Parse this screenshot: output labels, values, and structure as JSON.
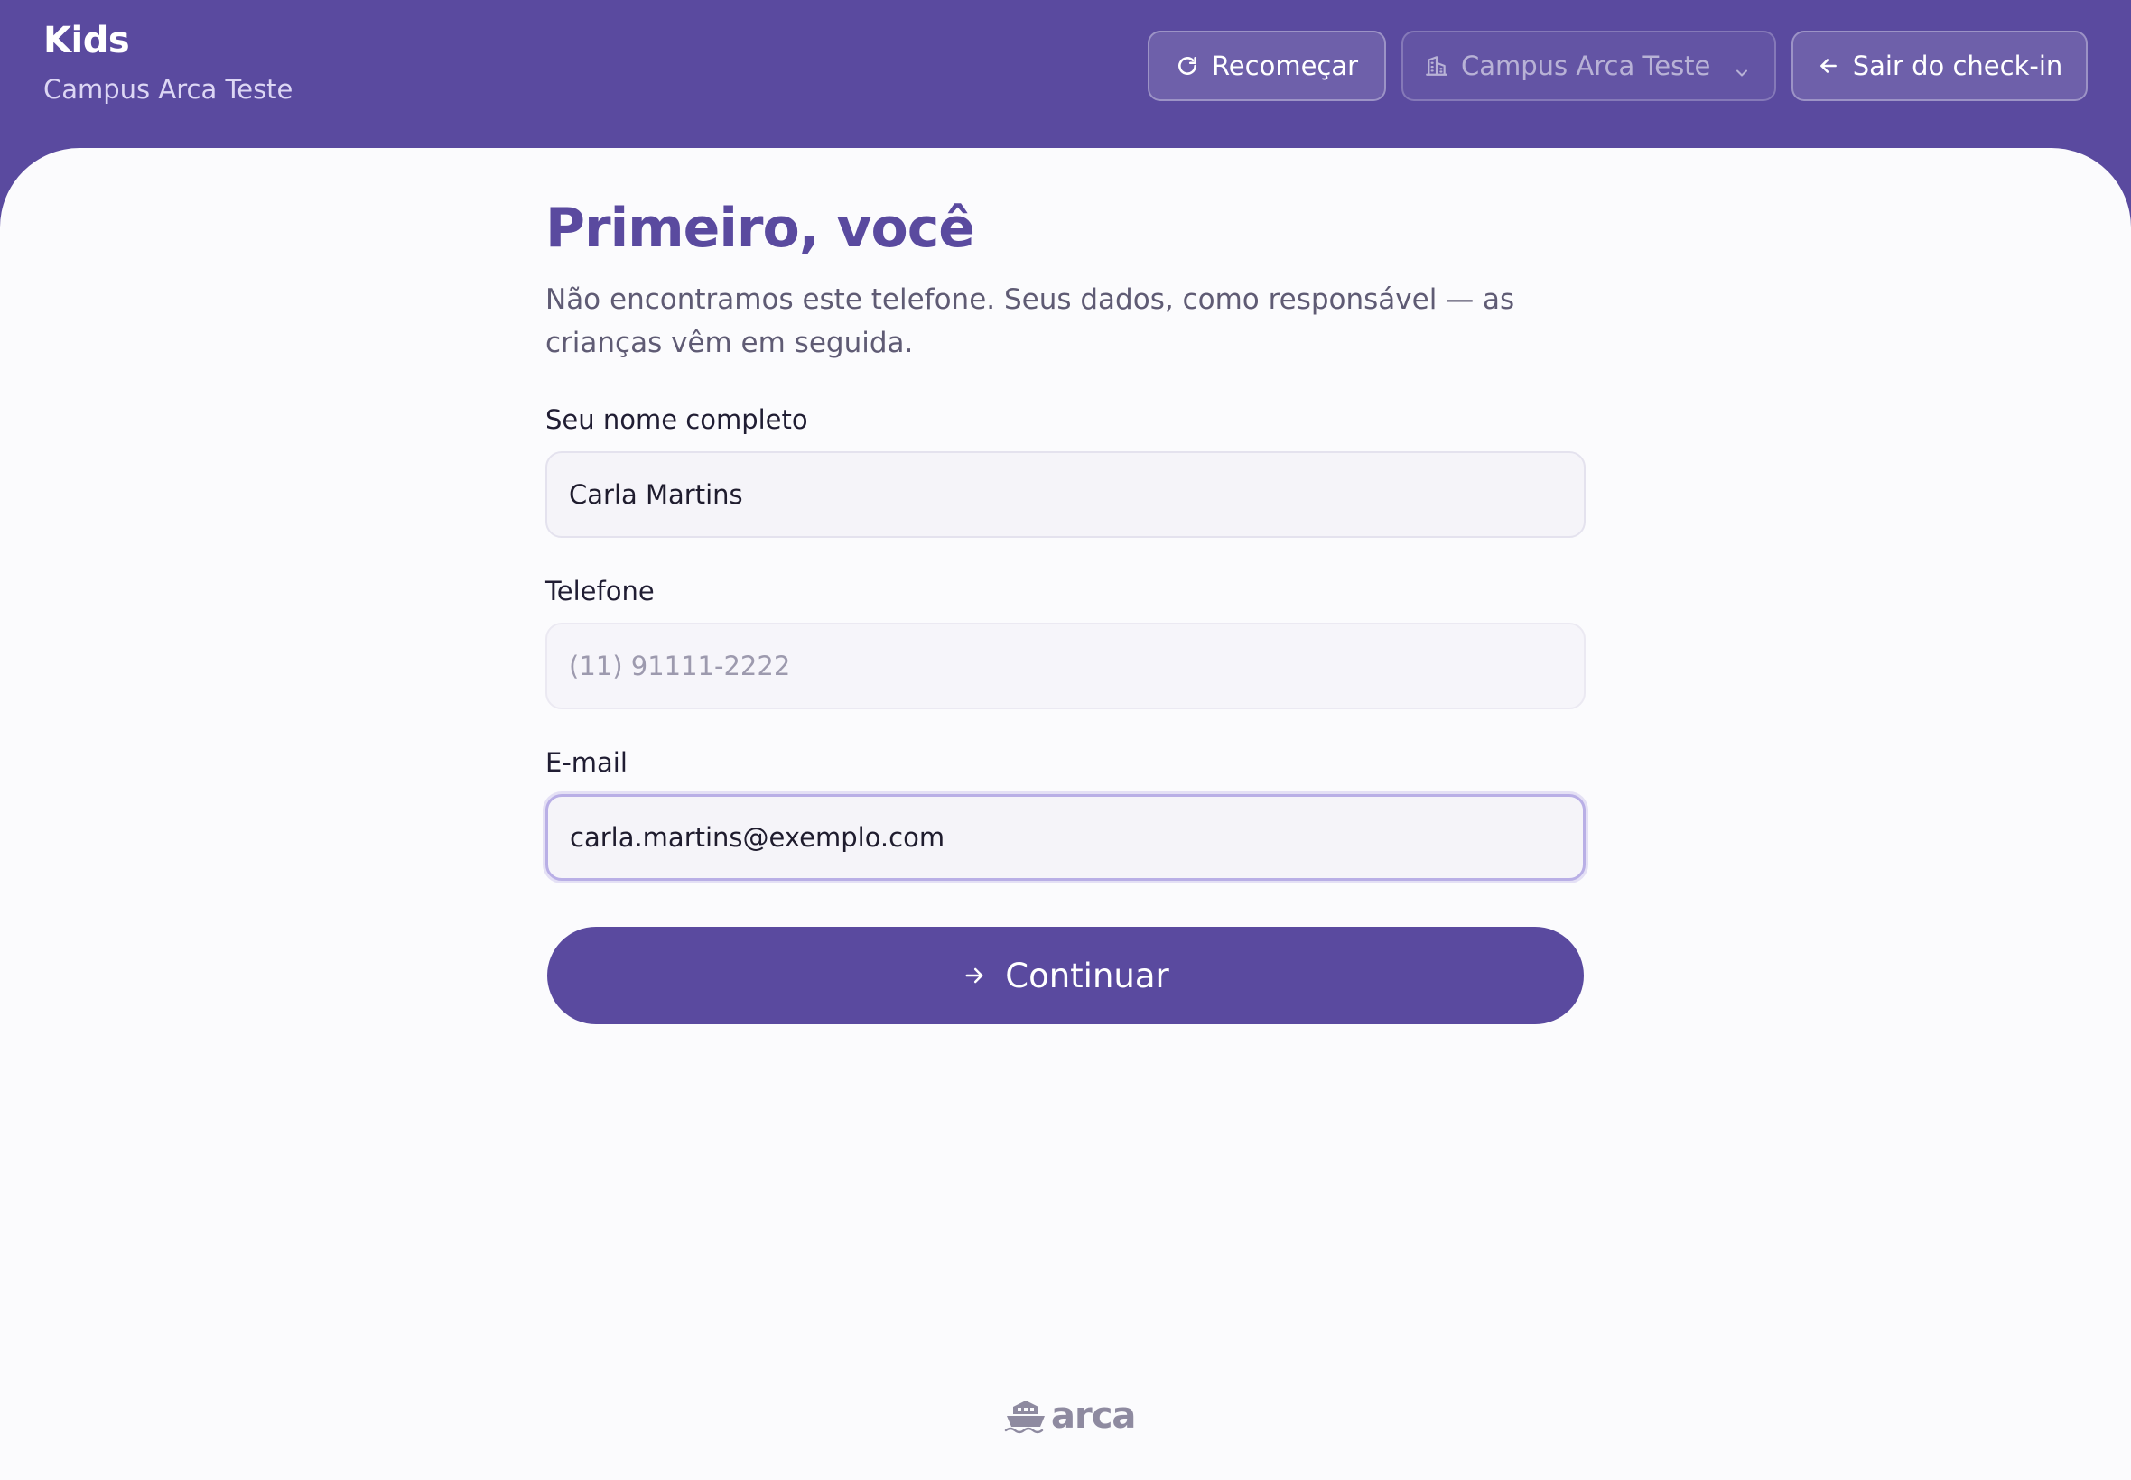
{
  "header": {
    "title": "Kids",
    "subtitle": "Campus Arca Teste",
    "restart_label": "Recomeçar",
    "restart_icon": "refresh-icon",
    "campus_select": {
      "value": "Campus Arca Teste",
      "icon": "building-icon"
    },
    "exit_label": "Sair do check-in",
    "exit_icon": "arrow-left-icon"
  },
  "form": {
    "heading": "Primeiro, você",
    "description": "Não encontramos este telefone. Seus dados, como responsável — as crianças vêm em seguida.",
    "name": {
      "label": "Seu nome completo",
      "value": "Carla Martins"
    },
    "phone": {
      "label": "Telefone",
      "value": "",
      "placeholder": "(11) 91111-2222"
    },
    "email": {
      "label": "E-mail",
      "value": "carla.martins@exemplo.com"
    },
    "submit_label": "Continuar",
    "submit_icon": "arrow-right-icon"
  },
  "footer": {
    "logo_text": "arca"
  },
  "colors": {
    "brand": "#5a4a9f",
    "background": "#fbfbfd",
    "field_background": "#f5f4f9",
    "focus_ring": "#b9afe6"
  }
}
